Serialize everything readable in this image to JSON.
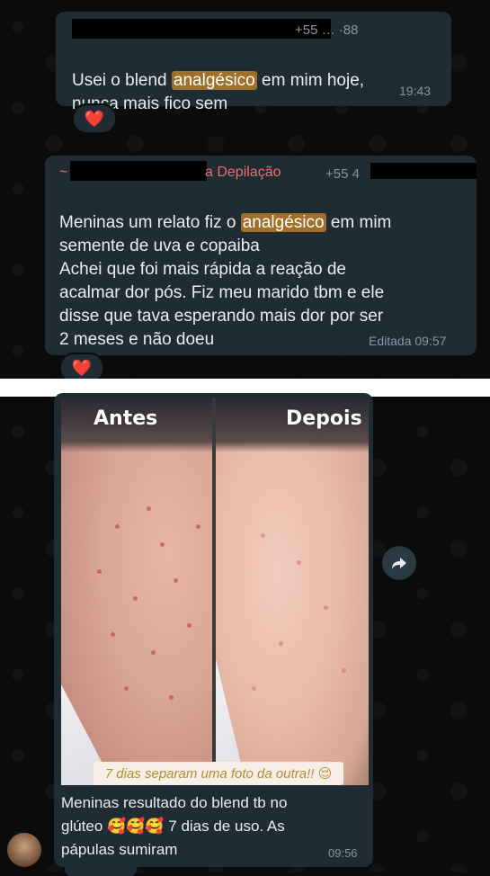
{
  "messages": [
    {
      "phone": "+55 … ·88",
      "text_before": "Usei o blend ",
      "highlight": "analgésico",
      "text_after": " em mim hoje,\nnunca mais fico sem",
      "time": "19:43",
      "reaction": "❤️"
    },
    {
      "sender": "~",
      "sender_suffix": "a Depilação",
      "phone": "+55 4",
      "text_before": "Meninas um relato fiz o ",
      "highlight": "analgésico",
      "text_after": " em mim\nsemente de uva e copaiba\nAchei que foi mais rápida a reação de\nacalmar dor pós. Fiz meu marido tbm e ele\ndisse que tava esperando mais dor por ser\n2 meses e não doeu",
      "time": "Editada 09:57",
      "reaction": "❤️"
    }
  ],
  "photo_message": {
    "label_left": "Antes",
    "label_right": "Depois",
    "overlay_caption": "7 dias separam uma foto da outra!! 😌",
    "caption": "Meninas resultado do blend tb no\nglúteo 🥰🥰🥰 7 dias de uso.  As\npápulas sumiram",
    "time": "09:56"
  },
  "icons": {
    "forward": "forward-arrow-icon",
    "avatar": "contact-avatar"
  },
  "colors": {
    "bubble": "#202c33",
    "highlight": "#a0702a",
    "sender": "#ef6a75",
    "meta": "#8696a0"
  }
}
